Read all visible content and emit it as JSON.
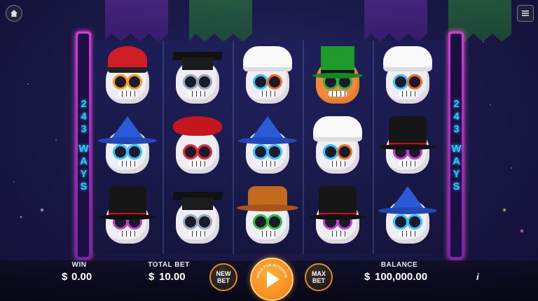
{
  "ways_text": {
    "number": "243",
    "word": "WAYS"
  },
  "reels": [
    [
      "mandarin-hat-skull",
      "wizard-hat-skull",
      "top-hat-skull"
    ],
    [
      "graduation-cap-skull",
      "beret-skull",
      "graduation-cap-skull"
    ],
    [
      "chef-hat-skull",
      "wizard-hat-skull",
      "cowboy-hat-skull"
    ],
    [
      "leprechaun-hat-skull",
      "chef-hat-skull",
      "top-hat-skull"
    ],
    [
      "chef-hat-skull",
      "top-hat-skull",
      "wizard-hat-skull"
    ]
  ],
  "bottom_bar": {
    "win_label": "WIN",
    "win_currency": "$",
    "win_value": "0.00",
    "total_bet_label": "TOTAL BET",
    "total_bet_currency": "$",
    "total_bet_value": "10.00",
    "new_bet_label": "NEW BET",
    "spin_ring_text": "HOLD FOR AUTOSPIN",
    "max_bet_label": "MAX BET",
    "balance_label": "BALANCE",
    "balance_currency": "$",
    "balance_value": "100,000.00",
    "info_label": "i"
  },
  "icons": {
    "home": "home-icon",
    "menu": "menu-icon"
  },
  "colors": {
    "accent": "#f07b12",
    "ways_frame": "#d23bd8",
    "ways_text": "#2ac8ff"
  }
}
